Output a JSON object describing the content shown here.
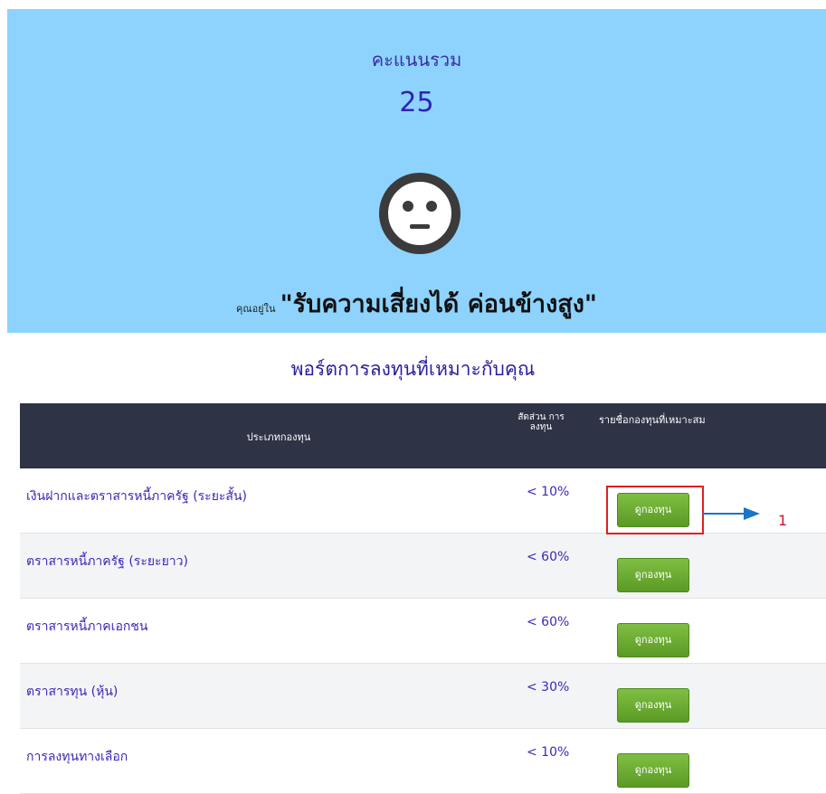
{
  "score": {
    "label": "คะแนนรวม",
    "value": "25",
    "face_icon": "neutral-face-icon",
    "risk_prefix": "คุณอยู่ใน",
    "risk_level": "\"รับความเสี่ยงได้ ค่อนข้างสูง\""
  },
  "portfolio": {
    "title": "พอร์ตการลงทุนที่เหมาะกับคุณ",
    "headers": {
      "type": "ประเภทกองทุน",
      "ratio": "สัดส่วน การ ลงทุน",
      "funds": "รายชื่อกองทุนที่เหมาะสม"
    },
    "rows": [
      {
        "type": "เงินฝากและตราสารหนี้ภาครัฐ (ระยะสั้น)",
        "ratio": "< 10%",
        "button": "ดูกองทุน"
      },
      {
        "type": "ตราสารหนี้ภาครัฐ (ระยะยาว)",
        "ratio": "< 60%",
        "button": "ดูกองทุน"
      },
      {
        "type": "ตราสารหนี้ภาคเอกชน",
        "ratio": "< 60%",
        "button": "ดูกองทุน"
      },
      {
        "type": "ตราสารทุน (หุ้น)",
        "ratio": "< 30%",
        "button": "ดูกองทุน"
      },
      {
        "type": "การลงทุนทางเลือก",
        "ratio": "< 10%",
        "button": "ดูกองทุน"
      }
    ]
  },
  "annotation": {
    "label": "1"
  },
  "colors": {
    "panel": "#8dd3fd",
    "header": "#2e3346",
    "button": "#6aab30",
    "highlight": "#e02020",
    "arrow": "#1a76c8"
  }
}
